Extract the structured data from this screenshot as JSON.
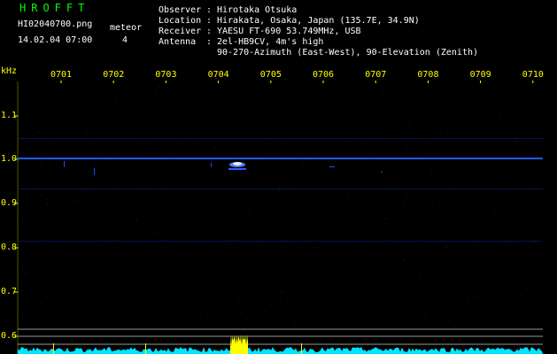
{
  "app": {
    "title": "HROFFT"
  },
  "file": {
    "name": "HI02040700.png",
    "datetime": "14.02.04 07:00"
  },
  "meteor": {
    "label": "meteor",
    "count": "4"
  },
  "station": {
    "observer_label": "Observer",
    "observer": "Hirotaka Otsuka",
    "location_label": "Location",
    "location": "Hirakata, Osaka, Japan (135.7E, 34.9N)",
    "receiver_label": "Receiver",
    "receiver": "YAESU FT-690 53.749MHz, USB",
    "antenna_label": "Antenna",
    "antenna_line1": "2el-HB9CV, 4m's high",
    "antenna_line2": "90-270-Azimuth (East-West), 90-Elevation (Zenith)"
  },
  "spectrogram": {
    "y_unit": "kHz",
    "time_ticks": [
      "0701",
      "0702",
      "0703",
      "0704",
      "0705",
      "0706",
      "0707",
      "0708",
      "0709",
      "0710"
    ],
    "freq_ticks": [
      "1.1",
      "1.0",
      "0.9",
      "0.8",
      "0.7",
      "0.6"
    ],
    "colors": {
      "background": "#000000",
      "signal": "#1a4cff",
      "meteor": "#e6f0ff",
      "noise": "#00e5ff",
      "burst": "#ffff00",
      "axis": "#ffff00"
    }
  }
}
